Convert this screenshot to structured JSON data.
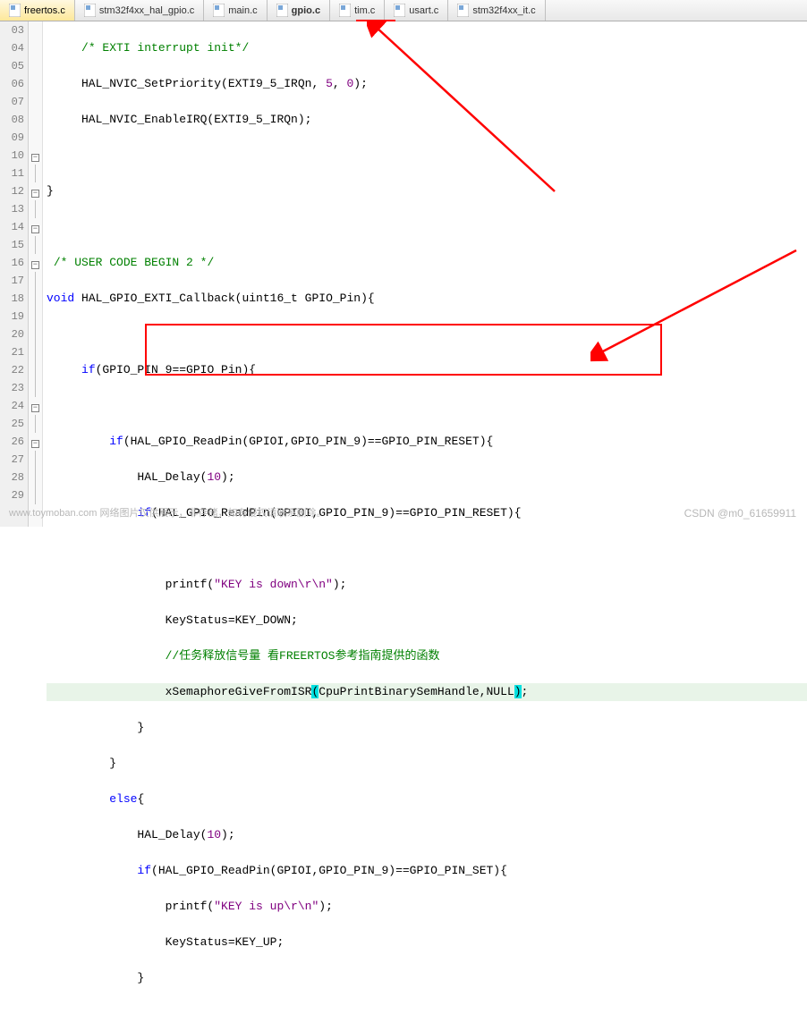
{
  "tabs": [
    {
      "label": "freertos.c",
      "active": true
    },
    {
      "label": "stm32f4xx_hal_gpio.c",
      "active": false
    },
    {
      "label": "main.c",
      "active": false
    },
    {
      "label": "gpio.c",
      "active": false,
      "selected": true
    },
    {
      "label": "tim.c",
      "active": false
    },
    {
      "label": "usart.c",
      "active": false
    },
    {
      "label": "stm32f4xx_it.c",
      "active": false
    }
  ],
  "line_numbers": [
    "03",
    "04",
    "05",
    "06",
    "07",
    "08",
    "09",
    "10",
    "11",
    "12",
    "13",
    "14",
    "15",
    "16",
    "17",
    "18",
    "19",
    "20",
    "21",
    "22",
    "23",
    "24",
    "25",
    "26",
    "27",
    "28",
    "29"
  ],
  "code": {
    "l03_cmt": "/* EXTI interrupt init*/",
    "l04": "     HAL_NVIC_SetPriority(EXTI9_5_IRQn, ",
    "l04_n1": "5",
    "l04_c": ", ",
    "l04_n2": "0",
    "l04_end": ");",
    "l05": "     HAL_NVIC_EnableIRQ(EXTI9_5_IRQn);",
    "l06": "",
    "l07": "}",
    "l08": "",
    "l09_cmt": "/* USER CODE BEGIN 2 */",
    "l10_kw": "void",
    "l10_rest": " HAL_GPIO_EXTI_Callback(uint16_t GPIO_Pin){",
    "l11": "",
    "l12_if": "if",
    "l12_rest": "(GPIO_PIN_9==GPIO_Pin){",
    "l13": "",
    "l14_if": "if",
    "l14_rest": "(HAL_GPIO_ReadPin(GPIOI,GPIO_PIN_9)==GPIO_PIN_RESET){",
    "l15_a": "             HAL_Delay(",
    "l15_n": "10",
    "l15_b": ");",
    "l16_if": "if",
    "l16_rest": "(HAL_GPIO_ReadPin(GPIOI,GPIO_PIN_9)==GPIO_PIN_RESET){",
    "l17": "",
    "l18_a": "                 printf(",
    "l18_s": "\"KEY is down\\r\\n\"",
    "l18_b": ");",
    "l19": "                 KeyStatus=KEY_DOWN;",
    "l20_cmt": "//任务释放信号量 看FREERTOS参考指南提供的函数",
    "l21_a": "                 xSemaphoreGiveFromISR",
    "l21_p1": "(",
    "l21_mid": "CpuPrintBinarySemHandle,NULL",
    "l21_p2": ")",
    "l21_end": ";",
    "l22": "             }",
    "l23": "         }",
    "l24_else": "else",
    "l24_rest": "{",
    "l25_a": "             HAL_Delay(",
    "l25_n": "10",
    "l25_b": ");",
    "l26_if": "if",
    "l26_rest": "(HAL_GPIO_ReadPin(GPIOI,GPIO_PIN_9)==GPIO_PIN_SET){",
    "l27_a": "                 printf(",
    "l27_s": "\"KEY is up\\r\\n\"",
    "l27_b": ");",
    "l28": "                 KeyStatus=KEY_UP;",
    "l29": "             }"
  },
  "fold": {
    "l10": "−",
    "l12": "−",
    "l14": "−",
    "l16": "−",
    "l24": "−",
    "l26": "−"
  },
  "watermark": {
    "left": "www.toymoban.com  网络图片仅供展示，非存储，如有侵权请联系删除。",
    "right": "CSDN @m0_61659911"
  }
}
